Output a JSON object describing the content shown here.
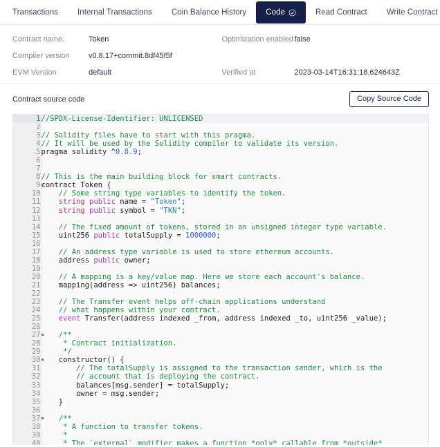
{
  "tabs": [
    {
      "label": "Transactions",
      "active": false,
      "icon": null
    },
    {
      "label": "Internal Transactions",
      "active": false,
      "icon": null
    },
    {
      "label": "Coin Balance History",
      "active": false,
      "icon": null
    },
    {
      "label": "Code",
      "active": true,
      "icon": "check-circle-icon"
    },
    {
      "label": "Read Contract",
      "active": false,
      "icon": null
    },
    {
      "label": "Write Contract",
      "active": false,
      "icon": null
    }
  ],
  "info": {
    "contract_name_label": "Contract name:",
    "contract_name_value": "Token",
    "optimization_label": "Optimization enabled",
    "optimization_value": "false",
    "compiler_label": "Compiler version",
    "compiler_value": "v0.8.17+commit.8df45f5f",
    "evm_label": "EVM Version",
    "evm_value": "default",
    "verified_label": "Verified at",
    "verified_value": "2023-03-14T16:31:18.624643Z"
  },
  "source": {
    "title": "Contract source code",
    "copy_button": "Copy Source Code"
  },
  "colors": {
    "accent_navy": "#16214a",
    "comment_green": "#228b45",
    "keyword_red": "#b0306a",
    "modifier_purple": "#a23bc4",
    "string_blue": "#2f7ca8",
    "number_blue": "#2f5fd0",
    "gutter_bg": "#f0f0f0",
    "code_bg": "#fafafa"
  },
  "code_lines": [
    {
      "n": 1,
      "fold": false,
      "hl": true,
      "tokens": [
        {
          "t": "cm",
          "s": "//SPDX-License-Identifier: UNLICENSED"
        }
      ]
    },
    {
      "n": 2,
      "fold": false,
      "hl": false,
      "tokens": []
    },
    {
      "n": 3,
      "fold": false,
      "hl": false,
      "tokens": [
        {
          "t": "cm",
          "s": "// Solidity files have to start with this pragma."
        }
      ]
    },
    {
      "n": 4,
      "fold": false,
      "hl": false,
      "tokens": [
        {
          "t": "cm",
          "s": "// It will be used by the Solidity compiler to validate its version."
        }
      ]
    },
    {
      "n": 5,
      "fold": false,
      "hl": false,
      "tokens": [
        {
          "t": "pl",
          "s": "pragma solidity ^"
        },
        {
          "t": "num",
          "s": "0.8.9"
        },
        {
          "t": "pl",
          "s": ";"
        }
      ]
    },
    {
      "n": 6,
      "fold": false,
      "hl": false,
      "tokens": []
    },
    {
      "n": 7,
      "fold": false,
      "hl": false,
      "tokens": []
    },
    {
      "n": 8,
      "fold": false,
      "hl": false,
      "tokens": [
        {
          "t": "cm",
          "s": "// This is the main building block for smart contracts."
        }
      ]
    },
    {
      "n": 9,
      "fold": true,
      "hl": false,
      "tokens": [
        {
          "t": "pl",
          "s": "contract Token {"
        }
      ]
    },
    {
      "n": 10,
      "fold": false,
      "hl": false,
      "tokens": [
        {
          "t": "cm",
          "s": "    // Some string type variables to identify the token."
        }
      ]
    },
    {
      "n": 11,
      "fold": false,
      "hl": false,
      "tokens": [
        {
          "t": "kw",
          "s": "    string "
        },
        {
          "t": "mod",
          "s": "public"
        },
        {
          "t": "pl",
          "s": " name = "
        },
        {
          "t": "str",
          "s": "\"Token\""
        },
        {
          "t": "pl",
          "s": ";"
        }
      ]
    },
    {
      "n": 12,
      "fold": false,
      "hl": false,
      "tokens": [
        {
          "t": "kw",
          "s": "    string "
        },
        {
          "t": "mod",
          "s": "public"
        },
        {
          "t": "pl",
          "s": " symbol = "
        },
        {
          "t": "str",
          "s": "\"TKN\""
        },
        {
          "t": "pl",
          "s": ";"
        }
      ]
    },
    {
      "n": 13,
      "fold": false,
      "hl": false,
      "tokens": []
    },
    {
      "n": 14,
      "fold": false,
      "hl": false,
      "tokens": [
        {
          "t": "cm",
          "s": "    // The fixed amount of tokens, stored in an unsigned integer type variable."
        }
      ]
    },
    {
      "n": 15,
      "fold": false,
      "hl": false,
      "tokens": [
        {
          "t": "pl",
          "s": "    uint256 "
        },
        {
          "t": "mod",
          "s": "public"
        },
        {
          "t": "pl",
          "s": " totalSupply = "
        },
        {
          "t": "num",
          "s": "1000000"
        },
        {
          "t": "pl",
          "s": ";"
        }
      ]
    },
    {
      "n": 16,
      "fold": false,
      "hl": false,
      "tokens": []
    },
    {
      "n": 17,
      "fold": false,
      "hl": false,
      "tokens": [
        {
          "t": "cm",
          "s": "    // An address type variable is used to store ethereum accounts."
        }
      ]
    },
    {
      "n": 18,
      "fold": false,
      "hl": false,
      "tokens": [
        {
          "t": "pl",
          "s": "    address "
        },
        {
          "t": "mod",
          "s": "public"
        },
        {
          "t": "pl",
          "s": " owner;"
        }
      ]
    },
    {
      "n": 19,
      "fold": false,
      "hl": false,
      "tokens": []
    },
    {
      "n": 20,
      "fold": false,
      "hl": false,
      "tokens": [
        {
          "t": "cm",
          "s": "    // A mapping is a key/value map. Here we store each account's balance."
        }
      ]
    },
    {
      "n": 21,
      "fold": false,
      "hl": false,
      "tokens": [
        {
          "t": "pl",
          "s": "    mapping(address => uint256) balances;"
        }
      ]
    },
    {
      "n": 22,
      "fold": false,
      "hl": false,
      "tokens": []
    },
    {
      "n": 23,
      "fold": false,
      "hl": false,
      "tokens": [
        {
          "t": "cm",
          "s": "    // The Transfer event helps off-chain applications understand"
        }
      ]
    },
    {
      "n": 24,
      "fold": false,
      "hl": false,
      "tokens": [
        {
          "t": "cm",
          "s": "    // what happens within your contract."
        }
      ]
    },
    {
      "n": 25,
      "fold": false,
      "hl": false,
      "tokens": [
        {
          "t": "mod",
          "s": "    event"
        },
        {
          "t": "pl",
          "s": " Transfer(address indexed _from, address indexed _to, uint256 _value);"
        }
      ]
    },
    {
      "n": 26,
      "fold": false,
      "hl": false,
      "tokens": []
    },
    {
      "n": 27,
      "fold": true,
      "hl": false,
      "tokens": [
        {
          "t": "cm",
          "s": "    /**"
        }
      ]
    },
    {
      "n": 28,
      "fold": false,
      "hl": false,
      "tokens": [
        {
          "t": "cm",
          "s": "     * Contract initialization."
        }
      ]
    },
    {
      "n": 29,
      "fold": false,
      "hl": false,
      "tokens": [
        {
          "t": "cm",
          "s": "     */"
        }
      ]
    },
    {
      "n": 30,
      "fold": true,
      "hl": false,
      "tokens": [
        {
          "t": "pl",
          "s": "    constructor() {"
        }
      ]
    },
    {
      "n": 31,
      "fold": false,
      "hl": false,
      "tokens": [
        {
          "t": "cm",
          "s": "        // The totalSupply is assigned to the transaction sender, which is the"
        }
      ]
    },
    {
      "n": 32,
      "fold": false,
      "hl": false,
      "tokens": [
        {
          "t": "cm",
          "s": "        // account that is deploying the contract."
        }
      ]
    },
    {
      "n": 33,
      "fold": false,
      "hl": false,
      "tokens": [
        {
          "t": "pl",
          "s": "        balances[msg.sender] = totalSupply;"
        }
      ]
    },
    {
      "n": 34,
      "fold": false,
      "hl": false,
      "tokens": [
        {
          "t": "pl",
          "s": "        owner = msg.sender;"
        }
      ]
    },
    {
      "n": 35,
      "fold": false,
      "hl": false,
      "tokens": [
        {
          "t": "pl",
          "s": "    }"
        }
      ]
    },
    {
      "n": 36,
      "fold": false,
      "hl": false,
      "tokens": []
    },
    {
      "n": 37,
      "fold": true,
      "hl": false,
      "tokens": [
        {
          "t": "cm",
          "s": "    /**"
        }
      ]
    },
    {
      "n": 38,
      "fold": false,
      "hl": false,
      "tokens": [
        {
          "t": "cm",
          "s": "     * A function to transfer tokens."
        }
      ]
    },
    {
      "n": 39,
      "fold": false,
      "hl": false,
      "tokens": [
        {
          "t": "cm",
          "s": "     *"
        }
      ]
    },
    {
      "n": 40,
      "fold": false,
      "hl": false,
      "tokens": [
        {
          "t": "cm",
          "s": "     * The `external` modifier makes a function *only* callable from *outside*"
        }
      ]
    }
  ]
}
